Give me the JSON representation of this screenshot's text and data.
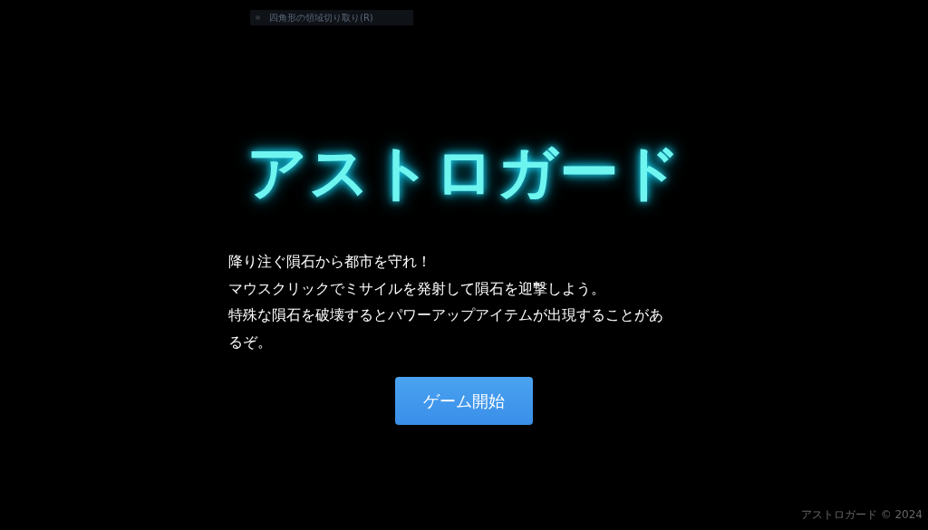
{
  "capture_hint": {
    "label": "四角形の領域切り取り(R)"
  },
  "title": "アストロガード",
  "description": {
    "lines": [
      "降り注ぐ隕石から都市を守れ！",
      "マウスクリックでミサイルを発射して隕石を迎撃しよう。",
      "特殊な隕石を破壊するとパワーアップアイテムが出現することがあ",
      "るぞ。"
    ]
  },
  "start_button": "ゲーム開始",
  "footer": "アストロガード © 2024"
}
